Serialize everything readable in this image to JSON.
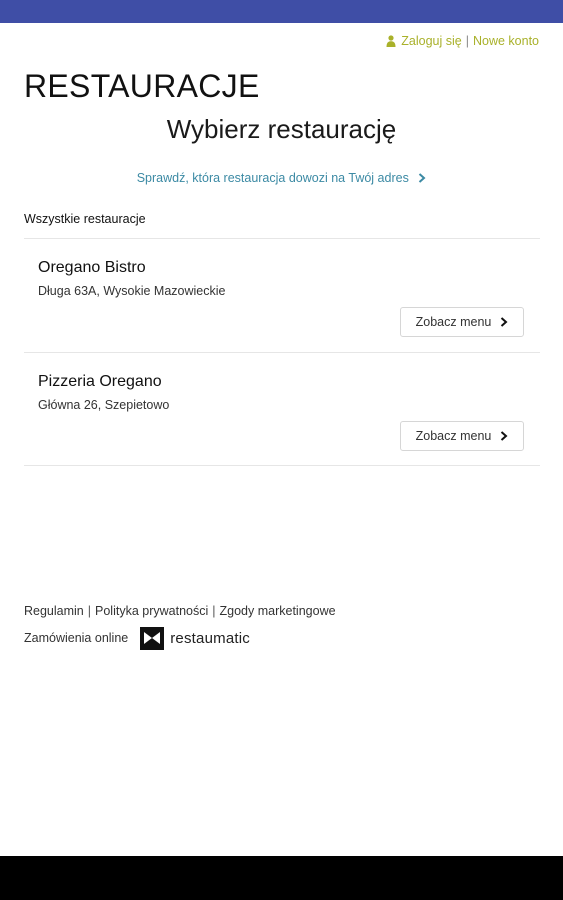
{
  "auth": {
    "login_label": "Zaloguj się",
    "separator": "|",
    "register_label": "Nowe konto",
    "icon": "user-icon"
  },
  "header": {
    "title": "RESTAURACJE",
    "subtitle": "Wybierz restaurację"
  },
  "delivery_check": {
    "label": "Sprawdź, która restauracja dowozi na Twój adres",
    "icon": "chevron-right-icon"
  },
  "section": {
    "label": "Wszystkie restauracje"
  },
  "restaurants": [
    {
      "name": "Oregano Bistro",
      "address": "Długa 63A, Wysokie Mazowieckie",
      "button_label": "Zobacz menu"
    },
    {
      "name": "Pizzeria Oregano",
      "address": "Główna 26, Szepietowo",
      "button_label": "Zobacz menu"
    }
  ],
  "footer": {
    "terms": "Regulamin",
    "privacy": "Polityka prywatności",
    "marketing": "Zgody marketingowe",
    "separator": "|",
    "online_orders": "Zamówienia online",
    "brand": "restaumatic",
    "brand_icon": "restaumatic-logo-icon"
  },
  "colors": {
    "status_bar": "#3f4ea6",
    "accent_links": "#a9b12a",
    "delivery_link": "#3c8aa4",
    "navigation_bar": "#000000"
  }
}
